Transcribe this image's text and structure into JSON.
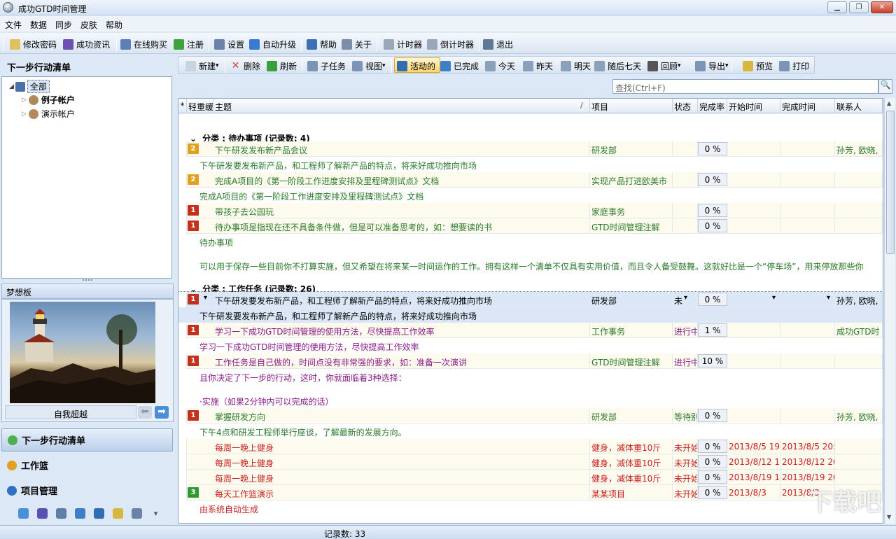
{
  "window": {
    "title": "成功GTD时间管理"
  },
  "menu": [
    "文件",
    "数据",
    "同步",
    "皮肤",
    "帮助"
  ],
  "toolbar1": [
    {
      "name": "change-password",
      "label": "修改密码",
      "icon": "key-note-icon",
      "color": "#e0c060"
    },
    {
      "name": "news",
      "label": "成功资讯",
      "icon": "book-icon",
      "color": "#6b4fb3"
    },
    {
      "name": "buy-online",
      "label": "在线购买",
      "icon": "cart-icon",
      "color": "#5c7fb5"
    },
    {
      "name": "register",
      "label": "注册",
      "icon": "recycle-icon",
      "color": "#3ea33e"
    },
    {
      "name": "settings",
      "label": "设置",
      "icon": "gear-icon",
      "color": "#6b83a8"
    },
    {
      "name": "auto-upgrade",
      "label": "自动升级",
      "icon": "up-arrow-icon",
      "color": "#3a7ad0"
    },
    {
      "name": "help",
      "label": "帮助",
      "icon": "question-icon",
      "color": "#3e6fb5"
    },
    {
      "name": "about",
      "label": "关于",
      "icon": "info-icon",
      "color": "#7a8ea8"
    },
    {
      "name": "timer",
      "label": "计时器",
      "icon": "clock-icon",
      "color": "#9aa7b8"
    },
    {
      "name": "countdown",
      "label": "倒计时器",
      "icon": "clock-icon",
      "color": "#9aa7b8"
    },
    {
      "name": "exit",
      "label": "退出",
      "icon": "exit-icon",
      "color": "#5f7898"
    }
  ],
  "left": {
    "header": "下一步行动清单",
    "tree": [
      {
        "label": "全部",
        "selected": true
      },
      {
        "label": "例子帐户",
        "bold": true
      },
      {
        "label": "演示帐户",
        "bold": false
      }
    ],
    "dream": {
      "header": "梦想板",
      "caption": "自我超越"
    },
    "nav": [
      {
        "label": "下一步行动清单",
        "icon_color": "#4caf50",
        "active": true
      },
      {
        "label": "工作篮",
        "icon_color": "#e0a020",
        "active": false
      },
      {
        "label": "项目管理",
        "icon_color": "#3070c0",
        "active": false
      }
    ],
    "small_icons": [
      {
        "icon": "people-icon",
        "color": "#4a90d9"
      },
      {
        "icon": "book-icon",
        "color": "#5a4fb3"
      },
      {
        "icon": "calendar-icon",
        "color": "#5f7fa8"
      },
      {
        "icon": "check-icon",
        "color": "#3e7fc8"
      },
      {
        "icon": "info-icon",
        "color": "#2f6db5"
      },
      {
        "icon": "note-icon",
        "color": "#d8b740"
      },
      {
        "icon": "folder-open-icon",
        "color": "#6b83a8"
      },
      {
        "icon": "dropdown-arrow-icon",
        "color": "#555"
      }
    ]
  },
  "toolbar2": [
    {
      "name": "new",
      "label": "新建",
      "icon": "doc-icon",
      "color": "#c8d3e0",
      "dropdown": true
    },
    {
      "name": "delete",
      "label": "删除",
      "icon": "x-icon",
      "color": "#d04040"
    },
    {
      "name": "refresh",
      "label": "刷新",
      "icon": "refresh-icon",
      "color": "#3aa03a"
    },
    {
      "name": "subtask",
      "label": "子任务",
      "icon": "subtask-icon",
      "color": "#7d95b5"
    },
    {
      "name": "view",
      "label": "视图",
      "icon": "view-icon",
      "color": "#7d95b5",
      "dropdown": true
    },
    {
      "name": "active",
      "label": "活动的",
      "icon": "info-icon",
      "color": "#2f6db5",
      "active": true
    },
    {
      "name": "completed",
      "label": "已完成",
      "icon": "check-icon",
      "color": "#3e7fc8"
    },
    {
      "name": "today",
      "label": "今天",
      "icon": "calendar-icon",
      "color": "#8aa0bb"
    },
    {
      "name": "yesterday",
      "label": "昨天",
      "icon": "calendar-icon",
      "color": "#8aa0bb"
    },
    {
      "name": "tomorrow",
      "label": "明天",
      "icon": "calendar-icon",
      "color": "#8aa0bb"
    },
    {
      "name": "next7",
      "label": "随后七天",
      "icon": "calendar-icon",
      "color": "#8aa0bb"
    },
    {
      "name": "review",
      "label": "回顾",
      "icon": "globe-icon",
      "color": "#555",
      "dropdown": true
    },
    {
      "name": "export",
      "label": "导出",
      "icon": "folder-icon",
      "color": "#7d95b5",
      "dropdown": true
    },
    {
      "name": "preview",
      "label": "预览",
      "icon": "preview-icon",
      "color": "#d8b740"
    },
    {
      "name": "print",
      "label": "打印",
      "icon": "printer-icon",
      "color": "#7d95b5"
    }
  ],
  "search": {
    "placeholder": "查找(Ctrl+F)"
  },
  "grid": {
    "columns": [
      "*",
      "轻重缓",
      "主题",
      "项目",
      "状态",
      "完成率",
      "开始时间",
      "完成时间",
      "联系人"
    ],
    "sort_indicator": "/",
    "groups": [
      {
        "label": "分类 : 待办事项 (记录数: 4)",
        "collapse": "⌄",
        "items": [
          {
            "pri": "2",
            "pri_color": "#e0a020",
            "subject": "下午研发发布新产品会议",
            "project": "研发部",
            "status": "",
            "pct": "0 %",
            "start": "",
            "end": "",
            "contact": "孙芳, 欧晓,",
            "color": "#2a7a2a",
            "bg": "#fdfbee",
            "desc": [
              "下午研发要发布新产品，和工程师了解新产品的特点，将来好成功推向市场"
            ]
          },
          {
            "pri": "2",
            "pri_color": "#e0a020",
            "subject": "完成A项目的《第一阶段工作进度安排及里程碑测试点》文档",
            "project": "实现产品打进欧美市",
            "status": "",
            "pct": "0 %",
            "start": "",
            "end": "",
            "contact": "",
            "color": "#2a7a2a",
            "bg": "#fdfbee",
            "desc": [
              "完成A项目的《第一阶段工作进度安排及里程碑测试点》文档"
            ]
          },
          {
            "pri": "1",
            "pri_color": "#c4301e",
            "subject": "带孩子去公园玩",
            "project": "家庭事务",
            "status": "",
            "pct": "0 %",
            "start": "",
            "end": "",
            "contact": "",
            "color": "#2a7a2a",
            "bg": "#fdfbee",
            "desc": []
          },
          {
            "pri": "1",
            "pri_color": "#c4301e",
            "subject": "待办事项是指现在还不具备条件做，但是可以准备思考的，如：想要读的书",
            "project": "GTD时间管理注解",
            "status": "",
            "pct": "0 %",
            "start": "",
            "end": "",
            "contact": "",
            "color": "#2a7a2a",
            "bg": "#fdfbee",
            "desc": [
              "待办事项",
              "",
              "可以用于保存一些目前你不打算实施，但又希望在将来某一时间运作的工作。拥有这样一个清单不仅具有实用价值，而且令人备受鼓舞。这就好比是一个“停车场”，用来停放那些你"
            ]
          }
        ]
      },
      {
        "label": "分类 : 工作任务 (记录数: 26)",
        "collapse": "⌄",
        "items": [
          {
            "pri": "1",
            "pri_color": "#c4301e",
            "subject": "下午研发要发布新产品，和工程师了解新产品的特点，将来好成功推向市场",
            "project": "研发部",
            "status": "未",
            "pct": "0 %",
            "start": "",
            "end": "",
            "contact": "孙芳, 欧晓,",
            "color": "#000000",
            "bg": "#dbe7f6",
            "selected": true,
            "desc": [
              "下午研发要发布新产品，和工程师了解新产品的特点，将来好成功推向市场"
            ]
          },
          {
            "pri": "1",
            "pri_color": "#c4301e",
            "subject": "学习一下成功GTD时间管理的使用方法，尽快提高工作效率",
            "project": "工作事务",
            "status": "进行中",
            "pct": "1 %",
            "start": "",
            "end": "",
            "contact": "成功GTD时",
            "color": "#8a1a8a",
            "bg": "#fdfbee",
            "desc": [
              "学习一下成功GTD时间管理的使用方法，尽快提高工作效率"
            ]
          },
          {
            "pri": "1",
            "pri_color": "#c4301e",
            "subject": "工作任务是自己做的，时间点没有非常强的要求，如：准备一次演讲",
            "project": "GTD时间管理注解",
            "status": "进行中",
            "pct": "10 %",
            "start": "",
            "end": "",
            "contact": "",
            "color": "#8a1a8a",
            "bg": "#fdfbee",
            "desc": [
              "且你决定了下一步的行动，这时，你就面临着3种选择：",
              "",
              "·实施（如果2分钟内可以完成的话）"
            ]
          },
          {
            "pri": "1",
            "pri_color": "#c4301e",
            "subject": "掌握研发方向",
            "project": "研发部",
            "status": "等待别",
            "pct": "0 %",
            "start": "",
            "end": "",
            "contact": "孙芳, 欧晓,",
            "color": "#2a7a2a",
            "bg": "#fdfbee",
            "desc": [
              "下午4点和研发工程师举行座谈，了解最新的发展方向。"
            ]
          },
          {
            "pri": "",
            "pri_color": "",
            "subject": "每周一晚上健身",
            "project": "健身，减体重10斤",
            "status": "未开始",
            "pct": "0 %",
            "start": "2013/8/5 19",
            "end": "2013/8/5 20:",
            "contact": "",
            "color": "#c81e1e",
            "bg": "#fdfbee",
            "desc": []
          },
          {
            "pri": "",
            "pri_color": "",
            "subject": "每周一晚上健身",
            "project": "健身，减体重10斤",
            "status": "未开始",
            "pct": "0 %",
            "start": "2013/8/12 1",
            "end": "2013/8/12 20",
            "contact": "",
            "color": "#c81e1e",
            "bg": "#fdfbee",
            "desc": []
          },
          {
            "pri": "",
            "pri_color": "",
            "subject": "每周一晚上健身",
            "project": "健身，减体重10斤",
            "status": "未开始",
            "pct": "0 %",
            "start": "2013/8/19 1",
            "end": "2013/8/19 20",
            "contact": "",
            "color": "#c81e1e",
            "bg": "#fdfbee",
            "desc": []
          },
          {
            "pri": "3",
            "pri_color": "#2f9a2f",
            "subject": "每天工作篮演示",
            "project": "某某项目",
            "status": "未开始",
            "pct": "0 %",
            "start": "2013/8/3",
            "end": "2013/8/3",
            "contact": "",
            "color": "#c81e1e",
            "bg": "#fdfbee",
            "desc": [
              "由系统自动生成"
            ]
          }
        ]
      }
    ]
  },
  "status": {
    "records": "记录数: 33"
  },
  "watermark": "下载吧"
}
